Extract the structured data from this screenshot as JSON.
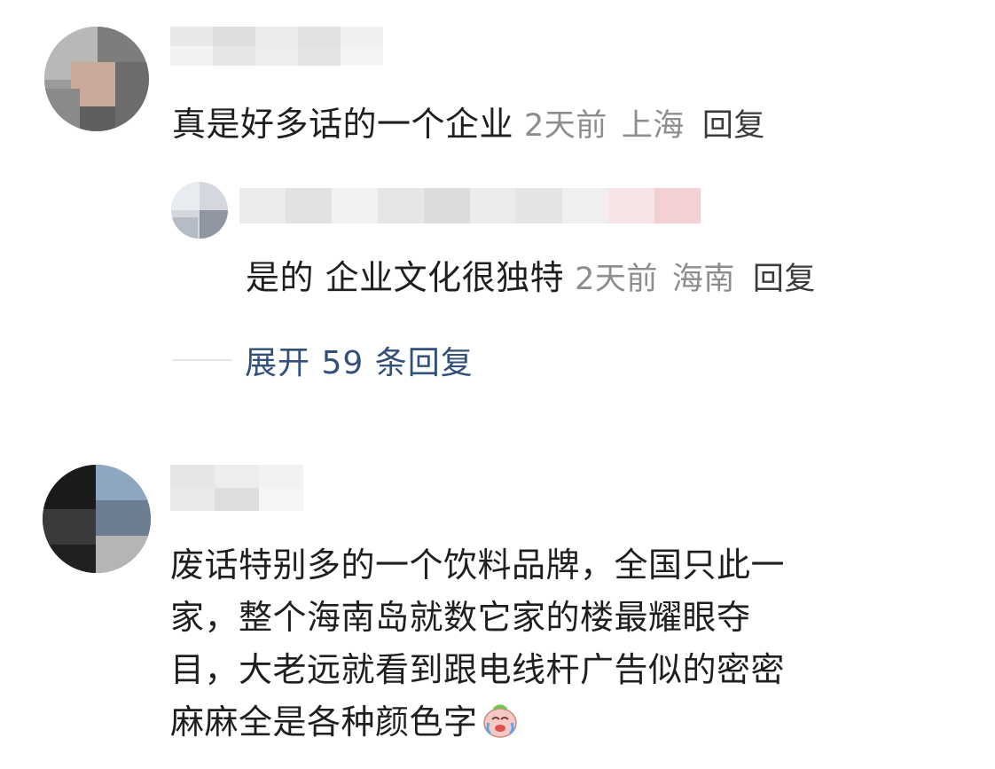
{
  "comments": [
    {
      "text": "真是好多话的一个企业",
      "time": "2天前",
      "location": "上海",
      "reply_label": "回复",
      "replies": [
        {
          "text": "是的 企业文化很独特",
          "time": "2天前",
          "location": "海南",
          "reply_label": "回复"
        }
      ],
      "expand_label": "展开 59 条回复"
    },
    {
      "lines": [
        "废话特别多的一个饮料品牌，全国只此一",
        "家，整个海南岛就数它家的楼最耀眼夺",
        "目，大老远就看到跟电线杆广告似的密密",
        "麻麻全是各种颜色字"
      ],
      "emoji": "crying-laughing-emoji"
    }
  ],
  "colors": {
    "text": "#1f1f1f",
    "meta": "#8d8d8d",
    "link": "#32507a",
    "divider": "#e3e3e3"
  }
}
